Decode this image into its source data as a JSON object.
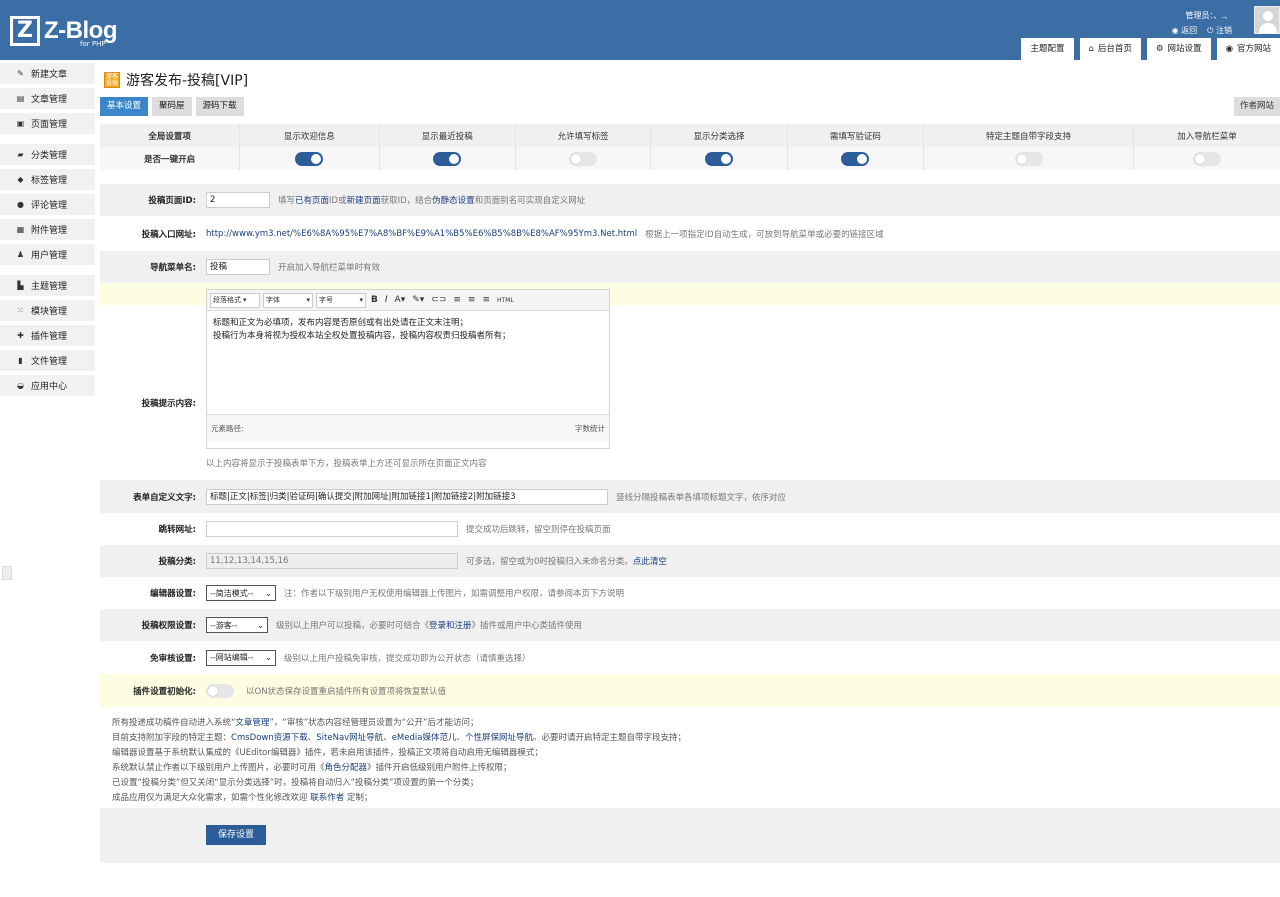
{
  "header": {
    "logo_letter": "Z",
    "logo_text": "Z-Blog",
    "logo_sub": "for PHP",
    "user_label": "管理员：",
    "user_name": "、.、",
    "back_link": "返回",
    "logout_link": "注销"
  },
  "topnav": [
    "主题配置",
    "后台首页",
    "网站设置",
    "官方网站"
  ],
  "sidebar": [
    {
      "label": "新建文章",
      "icon": "pencil-icon",
      "glyph": "✎"
    },
    {
      "label": "文章管理",
      "icon": "article-icon",
      "glyph": "▤"
    },
    {
      "label": "页面管理",
      "icon": "page-icon",
      "glyph": "▣"
    },
    {
      "label": "分类管理",
      "icon": "folder-icon",
      "glyph": "▰"
    },
    {
      "label": "标签管理",
      "icon": "tag-icon",
      "glyph": "◆"
    },
    {
      "label": "评论管理",
      "icon": "comment-icon",
      "glyph": "●"
    },
    {
      "label": "附件管理",
      "icon": "attachment-icon",
      "glyph": "▦"
    },
    {
      "label": "用户管理",
      "icon": "users-icon",
      "glyph": "♟"
    },
    {
      "label": "主题管理",
      "icon": "theme-icon",
      "glyph": "▙"
    },
    {
      "label": "模块管理",
      "icon": "module-icon",
      "glyph": "⁙"
    },
    {
      "label": "插件管理",
      "icon": "plugin-icon",
      "glyph": "✚"
    },
    {
      "label": "文件管理",
      "icon": "file-icon",
      "glyph": "▮"
    },
    {
      "label": "应用中心",
      "icon": "app-center-icon",
      "glyph": "◒"
    }
  ],
  "page_title": "游客发布-投稿[VIP]",
  "tabs": [
    "基本设置",
    "聚码屋",
    "源码下载"
  ],
  "author_button": "作者网站",
  "global": {
    "headers": [
      "全局设置项",
      "显示欢迎信息",
      "显示最近投稿",
      "允许填写标签",
      "显示分类选择",
      "需填写验证码",
      "特定主题自带字段支持",
      "加入导航栏菜单"
    ],
    "row_label": "是否一键开启",
    "toggles": [
      true,
      true,
      false,
      true,
      true,
      false,
      false
    ]
  },
  "fields": {
    "page_id": {
      "label": "投稿页面ID:",
      "value": "2",
      "hint_a": "填写",
      "hint_link1": "已有页面",
      "hint_b": "ID或",
      "hint_link2": "新建页面",
      "hint_c": "获取ID，结合",
      "hint_link3": "伪静态设置",
      "hint_d": "和页面别名可实现自定义网址"
    },
    "entry_url": {
      "label": "投稿入口网址:",
      "value": "http://www.ym3.net/%E6%8A%95%E7%A8%BF%E9%A1%B5%E6%B5%8B%E8%AF%95Ym3.Net.html",
      "hint": "根据上一项指定ID自动生成，可放到导航菜单或必要的链接区域"
    },
    "nav_name": {
      "label": "导航菜单名:",
      "value": "投稿",
      "hint": "开启加入导航栏菜单时有效"
    },
    "tips": {
      "label": "投稿提示内容:",
      "toolbar": [
        "段落格式",
        "字体",
        "字号"
      ],
      "line1": "标题和正文为必填项，发布内容是否原创或有出处请在正文末注明；",
      "line2": "投稿行为本身将视为授权本站全权处置投稿内容，投稿内容权责归投稿者所有；",
      "footer_left": "元素路径:",
      "footer_right": "字数统计",
      "hint": "以上内容将显示于投稿表单下方，投稿表单上方还可显示所在页面正文内容"
    },
    "form_text": {
      "label": "表单自定义文字:",
      "value": "标题|正文|标签|归类|验证码|确认提交|附加网址|附加链接1|附加链接2|附加链接3",
      "hint": "竖线分隔投稿表单各填项标题文字，依序对应"
    },
    "redirect": {
      "label": "跳转网址:",
      "value": "",
      "hint": "提交成功后跳转，留空则停在投稿页面"
    },
    "category": {
      "label": "投稿分类:",
      "value": "11,12,13,14,15,16",
      "hint": "可多选，留空或为0时投稿归入未命名分类。",
      "link": "点此清空"
    },
    "editor_mode": {
      "label": "编辑器设置:",
      "value": "--简洁模式--",
      "hint": "注：作者以下级别用户无权使用编辑器上传图片，如需调整用户权限，请参阅本页下方说明"
    },
    "permission": {
      "label": "投稿权限设置:",
      "value": "--游客--",
      "hint_a": "级别以上用户可以投稿，必要时可结合《",
      "hint_link": "登录和注册",
      "hint_b": "》插件或用户中心类插件使用"
    },
    "no_review": {
      "label": "免审核设置:",
      "value": "--网站编辑--",
      "hint": "级别以上用户投稿免审核，提交成功即为公开状态（请慎重选择）"
    },
    "reset": {
      "label": "插件设置初始化:",
      "hint": "以ON状态保存设置重启插件所有设置项将恢复默认值"
    }
  },
  "notes": {
    "l1a": "所有投递成功稿件自动进入系统“",
    "l1link": "文章管理",
    "l1b": "”，“审核”状态内容经管理员设置为“公开”后才能访问；",
    "l2a": "目前支持附加字段的特定主题：",
    "l2link1": "CmsDown资源下载",
    "l2sep1": "、",
    "l2link2": "SiteNav网址导航",
    "l2sep2": "、",
    "l2link3": "eMedia媒体范儿",
    "l2sep3": "、",
    "l2link4": "个性屏保网址导航",
    "l2b": "。必要时请开启特定主题自带字段支持；",
    "l3": "编辑器设置基于系统默认集成的《UEditor编辑器》插件，若未启用该插件，投稿正文项将自动启用无编辑器模式；",
    "l4a": "系统默认禁止作者以下级别用户上传图片，必要时可用《",
    "l4link": "角色分配器",
    "l4b": "》插件开启低级别用户附件上传权限；",
    "l5": "已设置“投稿分类”但又关闭“显示分类选择”时，投稿将自动归入“投稿分类”项设置的第一个分类；",
    "l6a": "成品应用仅为满足大众化需求，如需个性化修改欢迎 ",
    "l6link": "联系作者",
    "l6b": " 定制；"
  },
  "save_button": "保存设置"
}
